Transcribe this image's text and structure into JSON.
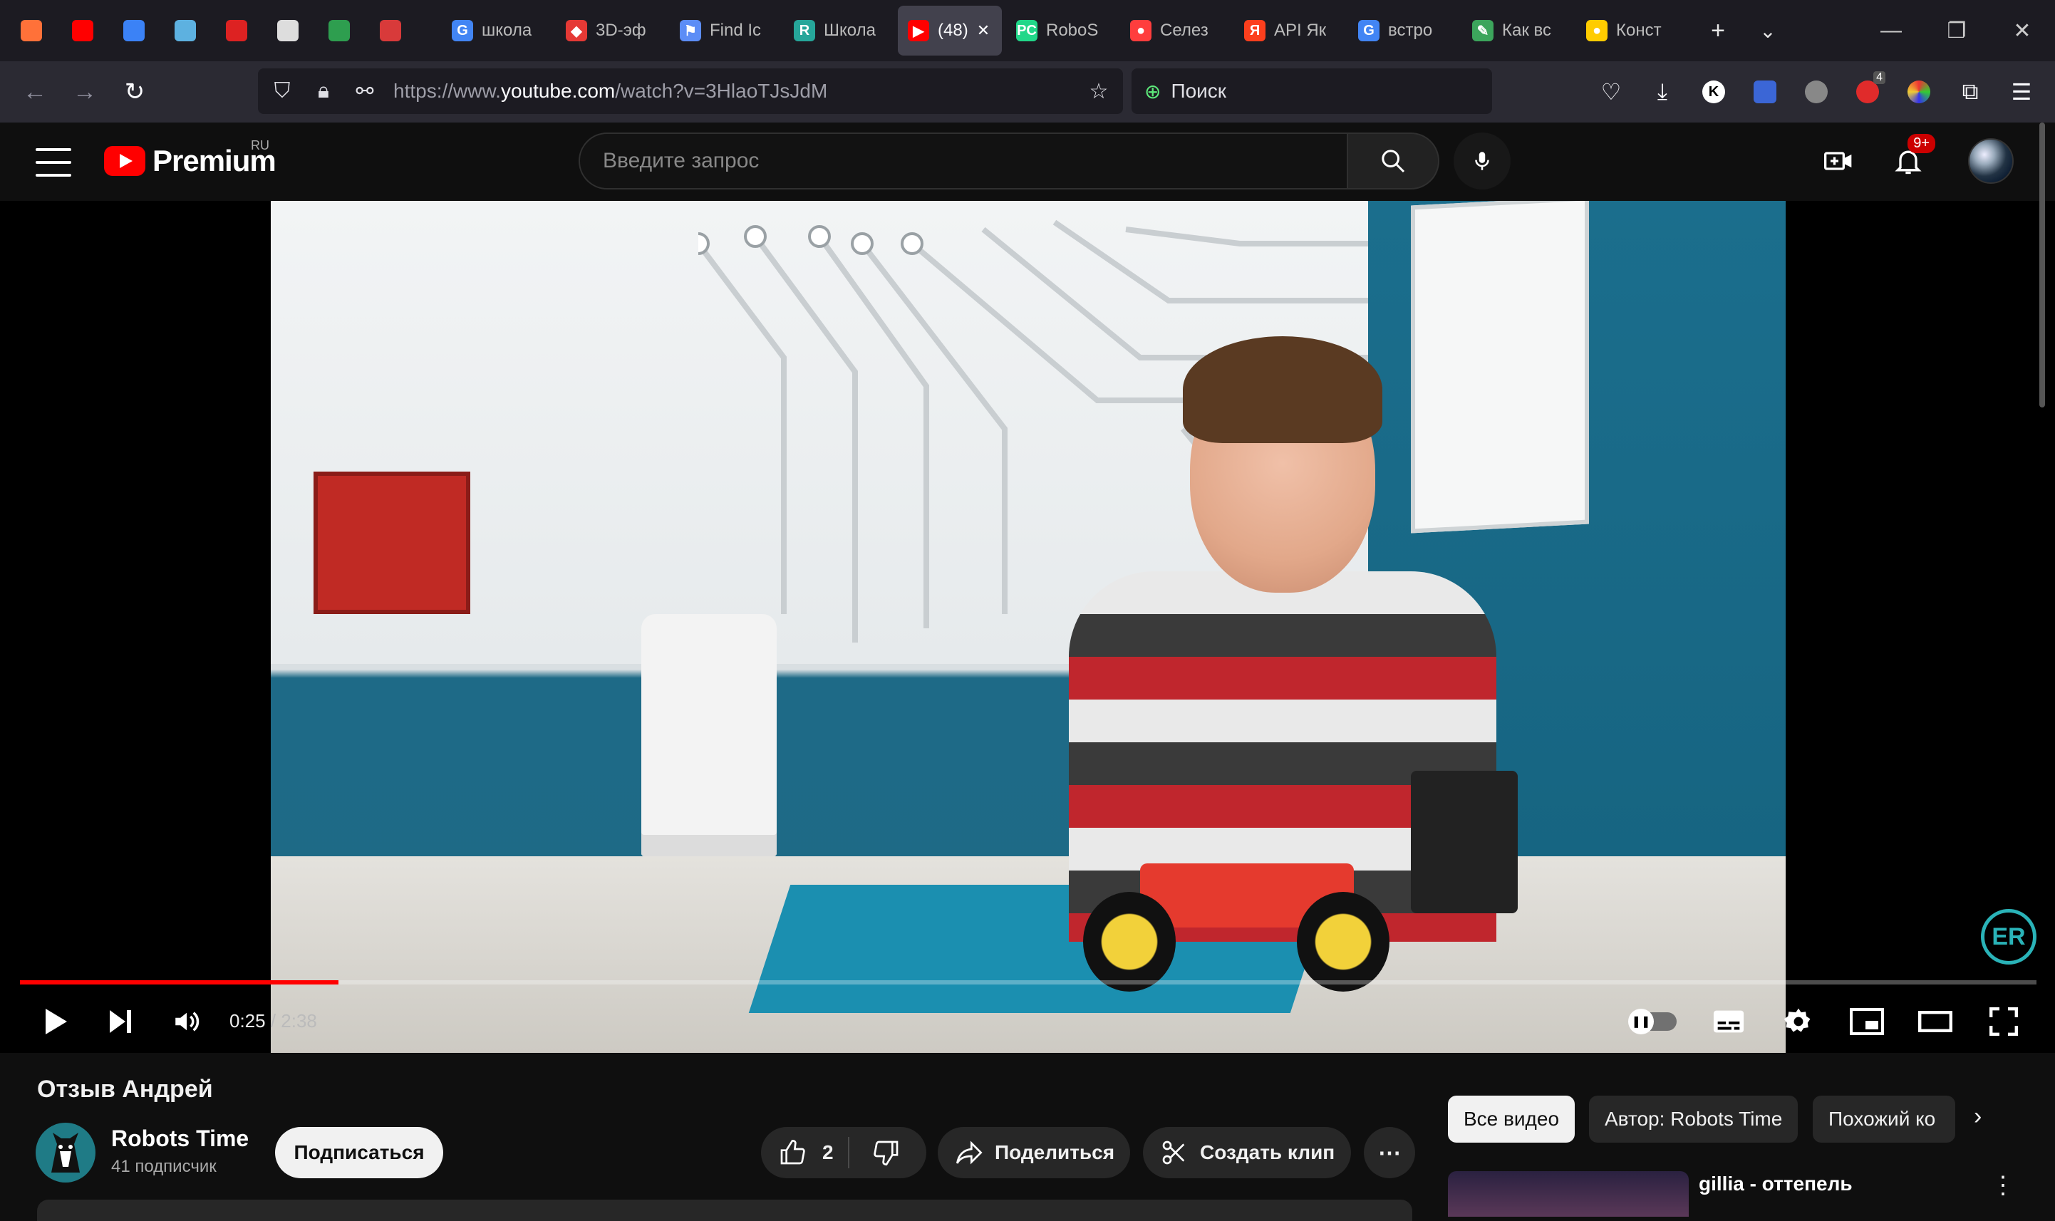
{
  "browser": {
    "pinned_tabs": [
      {
        "icon": "firefox-icon",
        "color": "#ff7139"
      },
      {
        "icon": "youtube-audio-icon",
        "color": "#ff0000"
      },
      {
        "icon": "library-icon",
        "color": "#3b82f6"
      },
      {
        "icon": "chat-icon",
        "color": "#5db1e0"
      },
      {
        "icon": "red-mark-icon",
        "color": "#d22"
      },
      {
        "icon": "m-icon",
        "color": "#ddd"
      },
      {
        "icon": "w-icon",
        "color": "#2e9e4f"
      },
      {
        "icon": "figure-icon",
        "color": "#d83a3a"
      }
    ],
    "tabs": [
      {
        "label": "школа",
        "icon": "google-icon",
        "color": "#4285f4",
        "letter": "G"
      },
      {
        "label": "3D-эф",
        "icon": "red-diamond-icon",
        "color": "#e53935",
        "letter": "◆"
      },
      {
        "label": "Find Ic",
        "icon": "flag-icon",
        "color": "#5c8df6",
        "letter": "⚑"
      },
      {
        "label": "Школа",
        "icon": "school-icon",
        "color": "#26a69a",
        "letter": "R"
      },
      {
        "label": "(48)",
        "icon": "youtube-icon",
        "color": "#ff0000",
        "letter": "▶",
        "active": true
      },
      {
        "label": "RoboS",
        "icon": "pycharm-icon",
        "color": "#21d789",
        "letter": "PC"
      },
      {
        "label": "Селез",
        "icon": "map-pin-icon",
        "color": "#ff3d3d",
        "letter": "●"
      },
      {
        "label": "API Як",
        "icon": "yandex-icon",
        "color": "#fc3f1d",
        "letter": "Я"
      },
      {
        "label": "встро",
        "icon": "google-icon",
        "color": "#4285f4",
        "letter": "G"
      },
      {
        "label": "Как вс",
        "icon": "doc-icon",
        "color": "#3ca55c",
        "letter": "✎"
      },
      {
        "label": "Конст",
        "icon": "constructor-icon",
        "color": "#ffcc00",
        "letter": "●"
      }
    ],
    "url": {
      "prefix": "https://www.",
      "host": "youtube.com",
      "path": "/watch?v=3HlaoTJsJdM"
    },
    "search_placeholder": "Поиск",
    "ext_badge": "4"
  },
  "youtube": {
    "brand": "Premium",
    "region": "RU",
    "search_placeholder": "Введите запрос",
    "notif_count": "9+",
    "player": {
      "current_time": "0:25",
      "duration": "2:38",
      "progress": 0.158
    },
    "video": {
      "title": "Отзыв Андрей",
      "channel": "Robots Time",
      "subscribers": "41 подписчик",
      "subscribe_label": "Подписаться",
      "likes": "2",
      "share_label": "Поделиться",
      "clip_label": "Создать клип"
    },
    "chips": [
      "Все видео",
      "Автор: Robots Time",
      "Похожий ко"
    ],
    "recommended": {
      "title": "gillia - оттепель"
    }
  }
}
